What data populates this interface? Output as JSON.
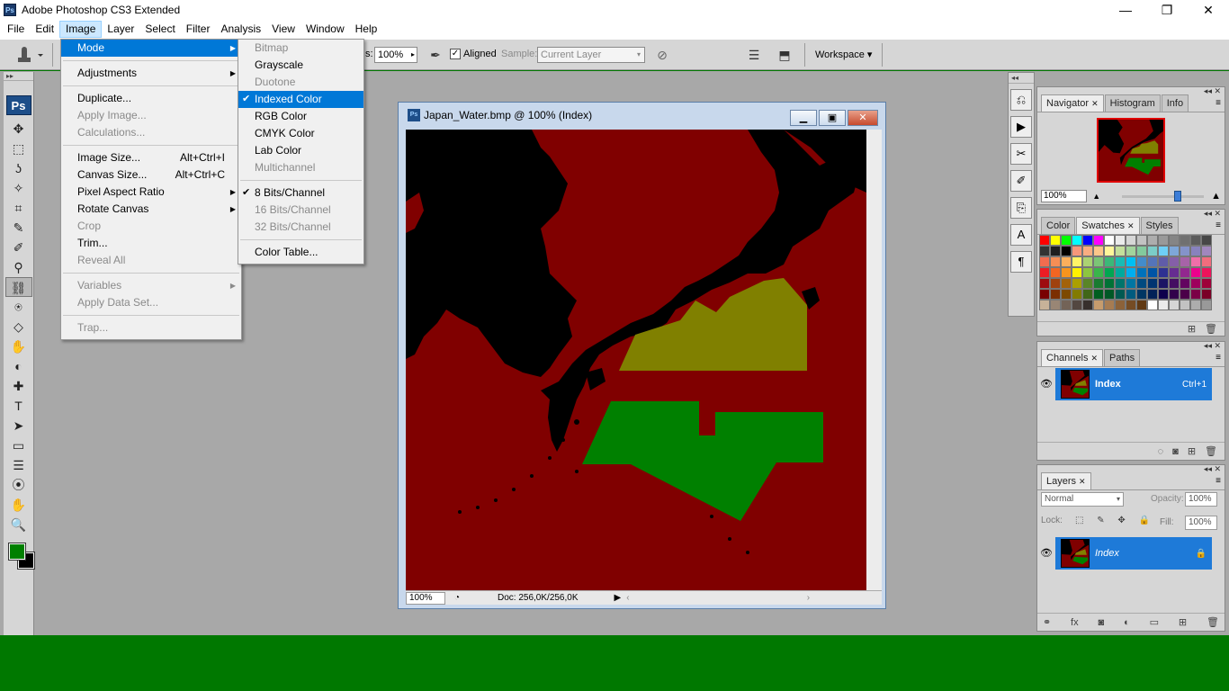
{
  "app": {
    "title": "Adobe Photoshop CS3 Extended",
    "icon_text": "Ps",
    "window_buttons": [
      "—",
      "❐",
      "✕"
    ]
  },
  "menubar": [
    "File",
    "Edit",
    "Image",
    "Layer",
    "Select",
    "Filter",
    "Analysis",
    "View",
    "Window",
    "Help"
  ],
  "options": {
    "partial_label": "s:",
    "opacity_value": "100%",
    "aligned_label": "Aligned",
    "aligned_checked": "✓",
    "sample_label": "Sample:",
    "sample_value": "Current Layer",
    "workspace_label": "Workspace ▾"
  },
  "toolbox": {
    "logo": "Ps",
    "tools": [
      "✥",
      "⬚",
      "ʖ",
      "✧",
      "⌗",
      "✎",
      "✐",
      "⚲",
      "⛓",
      "⍟",
      "◇",
      "✋",
      "◐",
      "✚",
      "T",
      "➤",
      "▭",
      "☰",
      "⦿",
      "✋",
      "🔍"
    ]
  },
  "image_menu": {
    "items": [
      {
        "label": "Mode",
        "submenu": true,
        "highlighted": true
      },
      {
        "sep": true
      },
      {
        "label": "Adjustments",
        "submenu": true
      },
      {
        "sep": true
      },
      {
        "label": "Duplicate..."
      },
      {
        "label": "Apply Image...",
        "disabled": true
      },
      {
        "label": "Calculations...",
        "disabled": true
      },
      {
        "sep": true
      },
      {
        "label": "Image Size...",
        "shortcut": "Alt+Ctrl+I"
      },
      {
        "label": "Canvas Size...",
        "shortcut": "Alt+Ctrl+C"
      },
      {
        "label": "Pixel Aspect Ratio",
        "submenu": true
      },
      {
        "label": "Rotate Canvas",
        "submenu": true
      },
      {
        "label": "Crop",
        "disabled": true
      },
      {
        "label": "Trim..."
      },
      {
        "label": "Reveal All",
        "disabled": true
      },
      {
        "sep": true
      },
      {
        "label": "Variables",
        "submenu": true,
        "disabled": true
      },
      {
        "label": "Apply Data Set...",
        "disabled": true
      },
      {
        "sep": true
      },
      {
        "label": "Trap...",
        "disabled": true
      }
    ]
  },
  "mode_menu": {
    "items": [
      {
        "label": "Bitmap",
        "disabled": true
      },
      {
        "label": "Grayscale"
      },
      {
        "label": "Duotone",
        "disabled": true
      },
      {
        "label": "Indexed Color",
        "checked": true,
        "highlighted": true
      },
      {
        "label": "RGB Color"
      },
      {
        "label": "CMYK Color"
      },
      {
        "label": "Lab Color"
      },
      {
        "label": "Multichannel",
        "disabled": true
      },
      {
        "sep": true
      },
      {
        "label": "8 Bits/Channel",
        "checked": true
      },
      {
        "label": "16 Bits/Channel",
        "disabled": true
      },
      {
        "label": "32 Bits/Channel",
        "disabled": true
      },
      {
        "sep": true
      },
      {
        "label": "Color Table..."
      }
    ]
  },
  "document": {
    "title": "Japan_Water.bmp @ 100% (Index)",
    "icon_text": "Ps",
    "zoom": "100%",
    "doc_info": "Doc: 256,0K/256,0K",
    "buttons": [
      "▁",
      "▣",
      "✕"
    ]
  },
  "colors": {
    "foreground": "#008000",
    "background": "#000000",
    "map_sea": "#800000",
    "map_land": "#000000",
    "region_olive": "#808000",
    "region_green": "#008000",
    "highlight": "#0078d7",
    "taskbar": "#007800"
  },
  "navigator": {
    "tabs": [
      "Navigator",
      "Histogram",
      "Info"
    ],
    "zoom": "100%"
  },
  "swatches_panel": {
    "tabs": [
      "Color",
      "Swatches",
      "Styles"
    ]
  },
  "channels_panel": {
    "tabs": [
      "Channels",
      "Paths"
    ],
    "channel_name": "Index",
    "channel_shortcut": "Ctrl+1"
  },
  "layers_panel": {
    "tabs": [
      "Layers"
    ],
    "blend_mode": "Normal",
    "opacity_label": "Opacity:",
    "opacity_value": "100%",
    "lock_label": "Lock:",
    "fill_label": "Fill:",
    "fill_value": "100%",
    "layer_name": "Index"
  }
}
